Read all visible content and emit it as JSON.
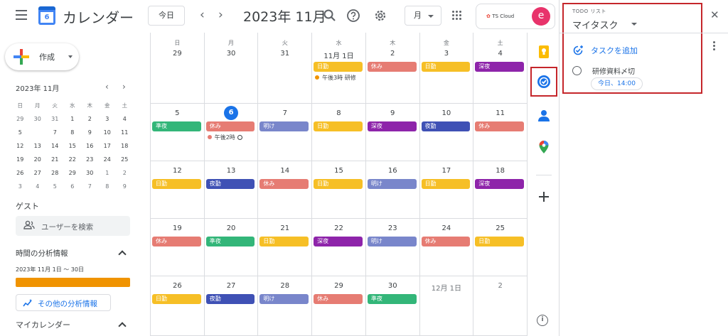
{
  "header": {
    "app_name": "カレンダー",
    "logo_day": "6",
    "today_label": "今日",
    "month_title": "2023年 11月",
    "view_label": "月",
    "org_name": "TS Cloud",
    "avatar_letter": "e"
  },
  "sidebar": {
    "create_label": "作成",
    "mini_title": "2023年 11月",
    "mini_weekdays": [
      "日",
      "月",
      "火",
      "水",
      "木",
      "金",
      "土"
    ],
    "mini_weeks": [
      [
        "29",
        "30",
        "31",
        "1",
        "2",
        "3",
        "4"
      ],
      [
        "5",
        "6",
        "7",
        "8",
        "9",
        "10",
        "11"
      ],
      [
        "12",
        "13",
        "14",
        "15",
        "16",
        "17",
        "18"
      ],
      [
        "19",
        "20",
        "21",
        "22",
        "23",
        "24",
        "25"
      ],
      [
        "26",
        "27",
        "28",
        "29",
        "30",
        "1",
        "2"
      ],
      [
        "3",
        "4",
        "5",
        "6",
        "7",
        "8",
        "9"
      ]
    ],
    "guest_title": "ゲスト",
    "guest_search_placeholder": "ユーザーを検索",
    "analytics_title": "時間の分析情報",
    "analytics_range": "2023年 11月 1日 ～ 30日",
    "analytics_more": "その他の分析情報",
    "my_calendars_title": "マイカレンダー"
  },
  "calendar": {
    "weekdays": [
      "日",
      "月",
      "火",
      "水",
      "木",
      "金",
      "土"
    ],
    "weeks": [
      [
        {
          "day": "29",
          "events": []
        },
        {
          "day": "30",
          "events": []
        },
        {
          "day": "31",
          "events": []
        },
        {
          "day": "11月 1日",
          "events": [
            {
              "type": "chip",
              "label": "日勤",
              "color": "#f6bf26"
            },
            {
              "type": "timed",
              "label": "午後3時 研修",
              "color": "#f09300"
            }
          ]
        },
        {
          "day": "2",
          "events": [
            {
              "type": "chip",
              "label": "休み",
              "color": "#e67c73"
            }
          ]
        },
        {
          "day": "3",
          "events": [
            {
              "type": "chip",
              "label": "日勤",
              "color": "#f6bf26"
            }
          ]
        },
        {
          "day": "4",
          "events": [
            {
              "type": "chip",
              "label": "深夜",
              "color": "#8e24aa"
            }
          ]
        }
      ],
      [
        {
          "day": "5",
          "events": [
            {
              "type": "chip",
              "label": "準夜",
              "color": "#33b679"
            }
          ]
        },
        {
          "day": "6",
          "today": true,
          "events": [
            {
              "type": "chip",
              "label": "休み",
              "color": "#e67c73"
            },
            {
              "type": "timed",
              "label": "午後2時",
              "color": "#e67c73",
              "task": true
            }
          ]
        },
        {
          "day": "7",
          "events": [
            {
              "type": "chip",
              "label": "明け",
              "color": "#7986cb"
            }
          ]
        },
        {
          "day": "8",
          "events": [
            {
              "type": "chip",
              "label": "日勤",
              "color": "#f6bf26"
            }
          ]
        },
        {
          "day": "9",
          "events": [
            {
              "type": "chip",
              "label": "深夜",
              "color": "#8e24aa"
            }
          ]
        },
        {
          "day": "10",
          "events": [
            {
              "type": "chip",
              "label": "夜勤",
              "color": "#3f51b5"
            }
          ]
        },
        {
          "day": "11",
          "events": [
            {
              "type": "chip",
              "label": "休み",
              "color": "#e67c73"
            }
          ]
        }
      ],
      [
        {
          "day": "12",
          "events": [
            {
              "type": "chip",
              "label": "日勤",
              "color": "#f6bf26"
            }
          ]
        },
        {
          "day": "13",
          "events": [
            {
              "type": "chip",
              "label": "夜勤",
              "color": "#3f51b5"
            }
          ]
        },
        {
          "day": "14",
          "events": [
            {
              "type": "chip",
              "label": "休み",
              "color": "#e67c73"
            }
          ]
        },
        {
          "day": "15",
          "events": [
            {
              "type": "chip",
              "label": "日勤",
              "color": "#f6bf26"
            }
          ]
        },
        {
          "day": "16",
          "events": [
            {
              "type": "chip",
              "label": "明け",
              "color": "#7986cb"
            }
          ]
        },
        {
          "day": "17",
          "events": [
            {
              "type": "chip",
              "label": "日勤",
              "color": "#f6bf26"
            }
          ]
        },
        {
          "day": "18",
          "events": [
            {
              "type": "chip",
              "label": "深夜",
              "color": "#8e24aa"
            }
          ]
        }
      ],
      [
        {
          "day": "19",
          "events": [
            {
              "type": "chip",
              "label": "休み",
              "color": "#e67c73"
            }
          ]
        },
        {
          "day": "20",
          "events": [
            {
              "type": "chip",
              "label": "準夜",
              "color": "#33b679"
            }
          ]
        },
        {
          "day": "21",
          "events": [
            {
              "type": "chip",
              "label": "日勤",
              "color": "#f6bf26"
            }
          ]
        },
        {
          "day": "22",
          "events": [
            {
              "type": "chip",
              "label": "深夜",
              "color": "#8e24aa"
            }
          ]
        },
        {
          "day": "23",
          "events": [
            {
              "type": "chip",
              "label": "明け",
              "color": "#7986cb"
            }
          ]
        },
        {
          "day": "24",
          "events": [
            {
              "type": "chip",
              "label": "休み",
              "color": "#e67c73"
            }
          ]
        },
        {
          "day": "25",
          "events": [
            {
              "type": "chip",
              "label": "日勤",
              "color": "#f6bf26"
            }
          ]
        }
      ],
      [
        {
          "day": "26",
          "events": [
            {
              "type": "chip",
              "label": "日勤",
              "color": "#f6bf26"
            }
          ]
        },
        {
          "day": "27",
          "events": [
            {
              "type": "chip",
              "label": "夜勤",
              "color": "#3f51b5"
            }
          ]
        },
        {
          "day": "28",
          "events": [
            {
              "type": "chip",
              "label": "明け",
              "color": "#7986cb"
            }
          ]
        },
        {
          "day": "29",
          "events": [
            {
              "type": "chip",
              "label": "休み",
              "color": "#e67c73"
            }
          ]
        },
        {
          "day": "30",
          "events": [
            {
              "type": "chip",
              "label": "準夜",
              "color": "#33b679"
            }
          ]
        },
        {
          "day": "12月 1日",
          "dim": true,
          "events": []
        },
        {
          "day": "2",
          "dim": true,
          "events": []
        }
      ]
    ]
  },
  "tasks_panel": {
    "small_title": "TODO リスト",
    "list_name": "マイタスク",
    "add_task_label": "タスクを追加",
    "tasks": [
      {
        "title": "研修資料〆切",
        "due": "今日、14:00"
      }
    ]
  },
  "colors": {
    "accent": "#1a73e8",
    "highlight_border": "#c5262b",
    "analytics_bar": "#f09300"
  }
}
